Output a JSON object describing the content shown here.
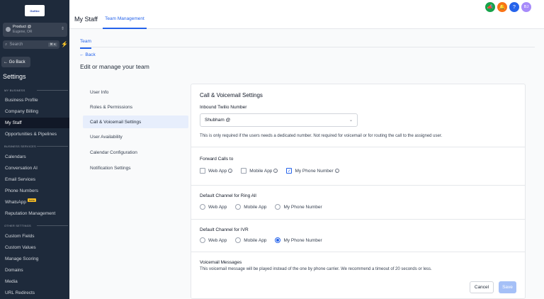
{
  "sidebar": {
    "logo_text": "GoHire",
    "account_name": "Product @",
    "account_location": "Eugene, OR",
    "search_placeholder": "Search",
    "search_shortcut": "⌘ K",
    "go_back": "Go Back",
    "settings_title": "Settings",
    "sections": [
      {
        "label": "MY BUSINESS",
        "items": [
          "Business Profile",
          "Company Billing",
          "My Staff",
          "Opportunities & Pipelines"
        ]
      },
      {
        "label": "BUSINESS SERVICES",
        "items": [
          "Calendars",
          "Conversation AI",
          "Email Services",
          "Phone Numbers",
          "WhatsApp",
          "Reputation Management"
        ]
      },
      {
        "label": "OTHER SETTINGS",
        "items": [
          "Custom Fields",
          "Custom Values",
          "Manage Scoring",
          "Domains",
          "Media",
          "URL Redirects"
        ]
      }
    ],
    "whatsapp_badge": "beta",
    "active_item": "My Staff"
  },
  "header": {
    "title": "My Staff",
    "tab": "Team Management",
    "avatar_initials": "BJ"
  },
  "main": {
    "subtab": "Team",
    "back": "Back",
    "heading": "Edit or manage your team",
    "menu": [
      "User Info",
      "Roles & Permissions",
      "Call & Voicemail Settings",
      "User Availability",
      "Calendar Configuration",
      "Notification Settings"
    ],
    "active_menu": "Call & Voicemail Settings"
  },
  "card": {
    "title": "Call & Voicemail Settings",
    "inbound_label": "Inbound Twilio Number",
    "inbound_value": "Shubham @",
    "inbound_help": "This is only required if the users needs a dedicated number. Not required for voicemail or for routing the call to the assigned user.",
    "forward_label": "Forward Calls to",
    "forward_options": [
      {
        "label": "Web App",
        "checked": false
      },
      {
        "label": "Mobile App",
        "checked": false
      },
      {
        "label": "My Phone Number",
        "checked": true
      }
    ],
    "ring_all_label": "Default Channel for Ring All",
    "ring_all_options": [
      "Web App",
      "Mobile App",
      "My Phone Number"
    ],
    "ring_all_selected": "",
    "ivr_label": "Default Channel for IVR",
    "ivr_options": [
      "Web App",
      "Mobile App",
      "My Phone Number"
    ],
    "ivr_selected": "My Phone Number",
    "voicemail_label": "Voicemail Messages",
    "voicemail_help": "This voicemail message will be played instead of the one by phone carrier. We recommend a timeout of 20 seconds or less.",
    "cancel": "Cancel",
    "save": "Save"
  },
  "colors": {
    "sidebar_bg": "#1e2a3b",
    "accent": "#2563eb",
    "save_disabled": "#a5c0f7"
  }
}
